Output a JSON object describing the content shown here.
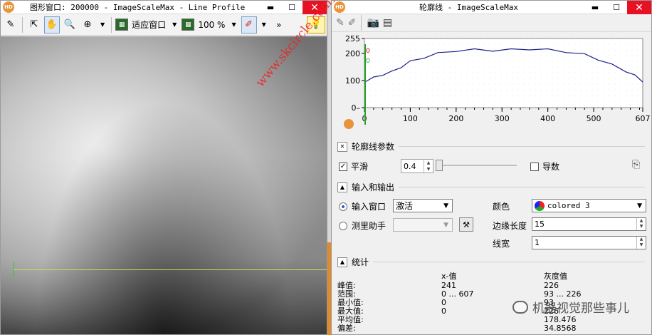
{
  "left_window": {
    "title": "图形窗口: 200000 - ImageScaleMax - Line Profile",
    "toolbar": {
      "fit_window_label": "适应窗口",
      "zoom_label": "100 %"
    }
  },
  "right_window": {
    "title": "轮廓线 - ImageScaleMax",
    "profile_params": {
      "section_title": "轮廓线参数",
      "smooth_label": "平滑",
      "smooth_value": "0.4",
      "smooth_checked": true,
      "derivative_label": "导数",
      "derivative_checked": false
    },
    "io": {
      "section_title": "输入和输出",
      "input_window_label": "输入窗口",
      "input_window_value": "激活",
      "measure_assistant_label": "测里助手",
      "color_label": "颜色",
      "color_value": "colored 3",
      "edge_length_label": "边缘长度",
      "edge_length_value": "15",
      "line_width_label": "线宽",
      "line_width_value": "1"
    },
    "stats": {
      "section_title": "统计",
      "col_x_header": "x-值",
      "col_gray_header": "灰度值",
      "rows": [
        {
          "label": "峰值:",
          "x": "241",
          "gray": "226"
        },
        {
          "label": "范围:",
          "x": "0 ... 607",
          "gray": "93 ... 226"
        },
        {
          "label": "最小值:",
          "x": "0",
          "gray": "93"
        },
        {
          "label": "最大值:",
          "x": "0",
          "gray": "226"
        },
        {
          "label": "平均值:",
          "x": "",
          "gray": "178.476"
        },
        {
          "label": "偏差:",
          "x": "",
          "gray": "34.8568"
        }
      ]
    }
  },
  "overlay": {
    "watermark": "www.skcircle.com勇哥",
    "wechat_text": "机器视觉那些事儿"
  },
  "chart_data": {
    "type": "line",
    "xlim": [
      0,
      607
    ],
    "ylim": [
      0,
      255
    ],
    "x_ticks": [
      0,
      100,
      200,
      300,
      400,
      500,
      607
    ],
    "y_ticks": [
      0,
      100,
      200,
      255
    ],
    "marker_labels": [
      "0",
      "0"
    ],
    "series": [
      {
        "color": "#1e1e8c",
        "x": [
          0,
          20,
          40,
          60,
          80,
          100,
          130,
          160,
          200,
          240,
          280,
          320,
          360,
          400,
          440,
          480,
          510,
          540,
          570,
          590,
          607
        ],
        "y": [
          93,
          110,
          122,
          132,
          150,
          170,
          185,
          200,
          210,
          214,
          211,
          214,
          216,
          214,
          206,
          196,
          178,
          158,
          135,
          118,
          94
        ]
      }
    ]
  }
}
